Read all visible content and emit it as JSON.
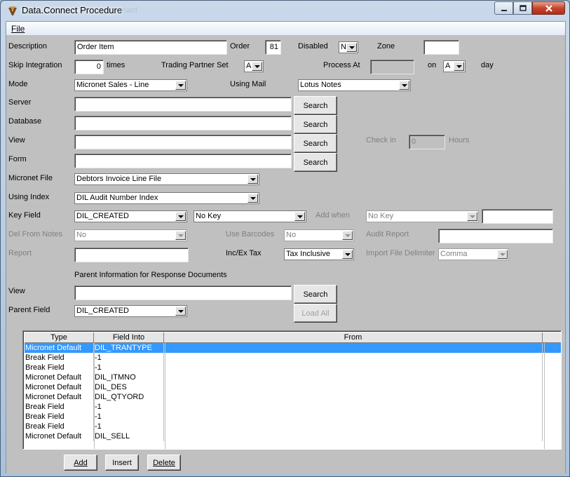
{
  "window": {
    "title": "Data.Connect Procedure",
    "ghost_text": "wnard",
    "controls": {
      "minimize": "minimize",
      "maximize": "maximize",
      "close": "close"
    }
  },
  "menu": {
    "file": "File"
  },
  "fields": {
    "description": {
      "label": "Description",
      "value": "Order Item"
    },
    "order": {
      "label": "Order",
      "value": "81"
    },
    "disabled": {
      "label": "Disabled",
      "value": "N"
    },
    "zone": {
      "label": "Zone",
      "value": ""
    },
    "skip_integration": {
      "label": "Skip Integration",
      "value": "0",
      "suffix": "times"
    },
    "trading_partner_set": {
      "label": "Trading Partner Set",
      "value": "A"
    },
    "process_at": {
      "label": "Process At",
      "value": ""
    },
    "on": {
      "label": "on",
      "value": "A"
    },
    "day": {
      "label": "day"
    },
    "mode": {
      "label": "Mode",
      "value": "Micronet Sales - Line"
    },
    "using_mail": {
      "label": "Using Mail",
      "value": "Lotus Notes"
    },
    "server": {
      "label": "Server",
      "value": "",
      "button": "Search"
    },
    "database": {
      "label": "Database",
      "value": "",
      "button": "Search"
    },
    "view": {
      "label": "View",
      "value": "",
      "button": "Search"
    },
    "form": {
      "label": "Form",
      "value": "",
      "button": "Search"
    },
    "check_in": {
      "label": "Check in",
      "value": "0",
      "suffix": "Hours"
    },
    "micronet_file": {
      "label": "Micronet File",
      "value": "Debtors Invoice Line File"
    },
    "using_index": {
      "label": "Using Index",
      "value": "DIL Audit Number Index"
    },
    "key_field": {
      "label": "Key Field",
      "value": "DIL_CREATED",
      "second_value": "No Key"
    },
    "add_when": {
      "label": "Add when",
      "value": "No Key",
      "text": ""
    },
    "del_from_notes": {
      "label": "Del From Notes",
      "value": "No"
    },
    "use_barcodes": {
      "label": "Use Barcodes",
      "value": "No"
    },
    "audit_report": {
      "label": "Audit Report",
      "value": ""
    },
    "report": {
      "label": "Report",
      "value": ""
    },
    "inc_ex_tax": {
      "label": "Inc/Ex Tax",
      "value": "Tax Inclusive"
    },
    "import_file_delimiter": {
      "label": "Import File Delimiter",
      "value": "Comma"
    },
    "parent_section_title": "Parent Information for Response Documents",
    "parent_view": {
      "label": "View",
      "value": "",
      "button": "Search"
    },
    "parent_field": {
      "label": "Parent Field",
      "value": "DIL_CREATED",
      "button": "Load All"
    }
  },
  "grid": {
    "columns": [
      "Type",
      "Field Into",
      "From",
      ""
    ],
    "rows": [
      {
        "type": "Micronet Default",
        "field_into": "DIL_TRANTYPE",
        "from": "",
        "selected": true
      },
      {
        "type": "Break Field",
        "field_into": "-1",
        "from": ""
      },
      {
        "type": "Break Field",
        "field_into": "-1",
        "from": ""
      },
      {
        "type": "Micronet Default",
        "field_into": "DIL_ITMNO",
        "from": ""
      },
      {
        "type": "Micronet Default",
        "field_into": "DIL_DES",
        "from": ""
      },
      {
        "type": "Micronet Default",
        "field_into": "DIL_QTYORD",
        "from": ""
      },
      {
        "type": "Break Field",
        "field_into": "-1",
        "from": ""
      },
      {
        "type": "Break Field",
        "field_into": "-1",
        "from": ""
      },
      {
        "type": "Break Field",
        "field_into": "-1",
        "from": ""
      },
      {
        "type": "Micronet Default",
        "field_into": "DIL_SELL",
        "from": ""
      }
    ]
  },
  "buttons": {
    "add": "Add",
    "insert": "Insert",
    "delete": "Delete"
  }
}
